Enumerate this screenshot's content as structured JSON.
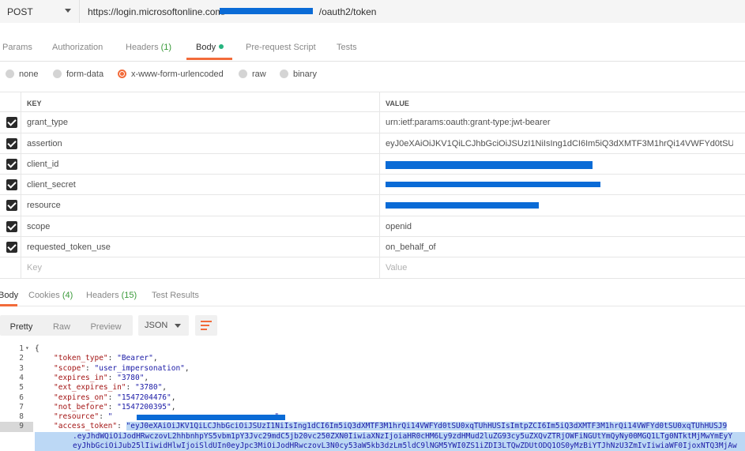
{
  "request": {
    "method": "POST",
    "url_prefix": "https://login.microsoftonline.com/",
    "url_suffix": "/oauth2/token"
  },
  "request_tabs": [
    {
      "label": "Params"
    },
    {
      "label": "Authorization"
    },
    {
      "label": "Headers",
      "count": "(1)"
    },
    {
      "label": "Body"
    },
    {
      "label": "Pre-request Script"
    },
    {
      "label": "Tests"
    }
  ],
  "body_modes": [
    "none",
    "form-data",
    "x-www-form-urlencoded",
    "raw",
    "binary"
  ],
  "selected_body_mode": "x-www-form-urlencoded",
  "table": {
    "headers": {
      "key": "KEY",
      "value": "VALUE"
    },
    "rows": [
      {
        "key": "grant_type",
        "value": "urn:ietf:params:oauth:grant-type:jwt-bearer",
        "redacted": false
      },
      {
        "key": "assertion",
        "value": "eyJ0eXAiOiJKV1QiLCJhbGciOiJSUzI1NiIsIng1dCI6Im5iQ3dXMTF3M1hrQi14VWFYd0tSU0xq...",
        "redacted": false
      },
      {
        "key": "client_id",
        "value": "",
        "redacted": true
      },
      {
        "key": "client_secret",
        "value": "",
        "redacted": true
      },
      {
        "key": "resource",
        "value": "",
        "redacted": true
      },
      {
        "key": "scope",
        "value": "openid",
        "redacted": false
      },
      {
        "key": "requested_token_use",
        "value": "on_behalf_of",
        "redacted": false
      }
    ],
    "placeholder": {
      "key": "Key",
      "value": "Value"
    }
  },
  "response_tabs": [
    {
      "label": "Body"
    },
    {
      "label": "Cookies",
      "count": "(4)"
    },
    {
      "label": "Headers",
      "count": "(15)"
    },
    {
      "label": "Test Results"
    }
  ],
  "view": {
    "modes": [
      "Pretty",
      "Raw",
      "Preview"
    ],
    "format": "JSON"
  },
  "response_lines": {
    "l1": "{",
    "l2k": "\"token_type\"",
    "l2v": "\"Bearer\"",
    "l3k": "\"scope\"",
    "l3v": "\"user_impersonation\"",
    "l4k": "\"expires_in\"",
    "l4v": "\"3780\"",
    "l5k": "\"ext_expires_in\"",
    "l5v": "\"3780\"",
    "l6k": "\"expires_on\"",
    "l6v": "\"1547204476\"",
    "l7k": "\"not_before\"",
    "l7v": "\"1547200395\"",
    "l8k": "\"resource\"",
    "l8v": "\"",
    "l9k": "\"access_token\"",
    "l9v": "\"eyJ0eXAiOiJKV1QiLCJhbGciOiJSUzI1NiIsIng1dCI6Im5iQ3dXMTF3M1hrQi14VWFYd0tSU0xqTUhHUSIsImtpZCI6Im5iQ3dXMTF3M1hrQi14VWFYd0tSU0xqTUhHUSJ9",
    "l9b": ".eyJhdWQiOiJodHRwczovL2hhbnhpYS5vbm1pY3Jvc29mdC5jb20vc250ZXN0IiwiaXNzIjoiaHR0cHM6Ly9zdHMud2luZG93cy5uZXQvZTRjOWFiNGUtYmQyNy00MGQ1LTg0NTktMjMwYmEyY",
    "l9c": "eyJhbGciOiJub25lIiwidHlwIjoiSldUIn0eyJpc3MiOiJodHRwczovL3N0cy53aW5kb3dzLm5ldC9lNGM5YWI0ZS1iZDI3LTQwZDUtODQ1OS0yMzBiYTJhNzU3ZmIvIiwiaWF0IjoxNTQ3MjAw"
  }
}
